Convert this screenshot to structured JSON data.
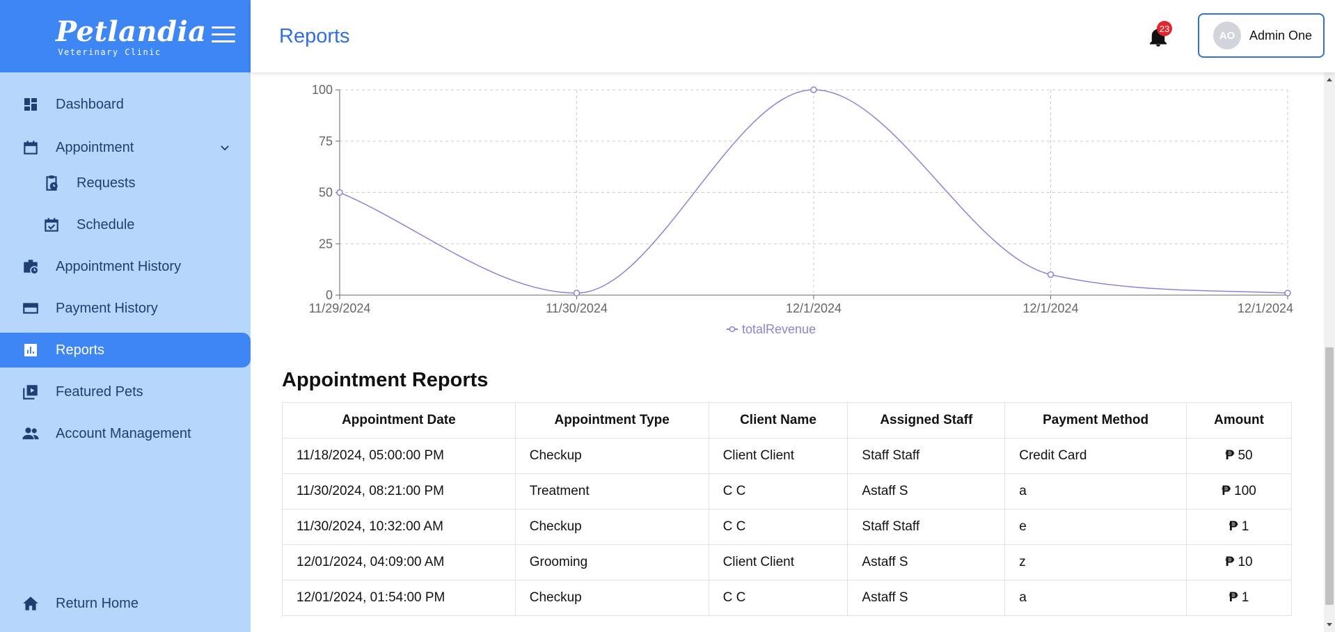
{
  "brand": {
    "name": "Petlandia",
    "tagline": "Veterinary Clinic"
  },
  "sidebar": {
    "items": [
      {
        "label": "Dashboard"
      },
      {
        "label": "Appointment"
      },
      {
        "label": "Requests"
      },
      {
        "label": "Schedule"
      },
      {
        "label": "Appointment History"
      },
      {
        "label": "Payment History"
      },
      {
        "label": "Reports"
      },
      {
        "label": "Featured Pets"
      },
      {
        "label": "Account Management"
      }
    ],
    "footer": {
      "label": "Return Home"
    }
  },
  "header": {
    "title": "Reports",
    "notification_count": "23",
    "user": {
      "initials": "AO",
      "name": "Admin One"
    }
  },
  "chart_data": {
    "type": "line",
    "x": [
      "11/29/2024",
      "11/30/2024",
      "12/1/2024",
      "12/1/2024",
      "12/1/2024"
    ],
    "series": [
      {
        "name": "totalRevenue",
        "values": [
          50,
          1,
          100,
          10,
          1
        ],
        "color": "#8884d8"
      }
    ],
    "yticks": [
      "0",
      "25",
      "50",
      "75",
      "100"
    ],
    "ylim": [
      0,
      100
    ],
    "grid": true,
    "legend": "bottom"
  },
  "table": {
    "title": "Appointment Reports",
    "columns": [
      "Appointment Date",
      "Appointment Type",
      "Client Name",
      "Assigned Staff",
      "Payment Method",
      "Amount"
    ],
    "currency": "₱",
    "rows": [
      [
        "11/18/2024, 05:00:00 PM",
        "Checkup",
        "Client Client",
        "Staff Staff",
        "Credit Card",
        "50"
      ],
      [
        "11/30/2024, 08:21:00 PM",
        "Treatment",
        "C C",
        "Astaff S",
        "a",
        "100"
      ],
      [
        "11/30/2024, 10:32:00 AM",
        "Checkup",
        "C C",
        "Staff Staff",
        "e",
        "1"
      ],
      [
        "12/01/2024, 04:09:00 AM",
        "Grooming",
        "Client Client",
        "Astaff S",
        "z",
        "10"
      ],
      [
        "12/01/2024, 01:54:00 PM",
        "Checkup",
        "C C",
        "Astaff S",
        "a",
        "1"
      ]
    ]
  },
  "colors": {
    "brand": "#3d86f3",
    "sidebar": "#b7d6fb",
    "accent": "#2f6fe0",
    "badge": "#e3262b"
  }
}
